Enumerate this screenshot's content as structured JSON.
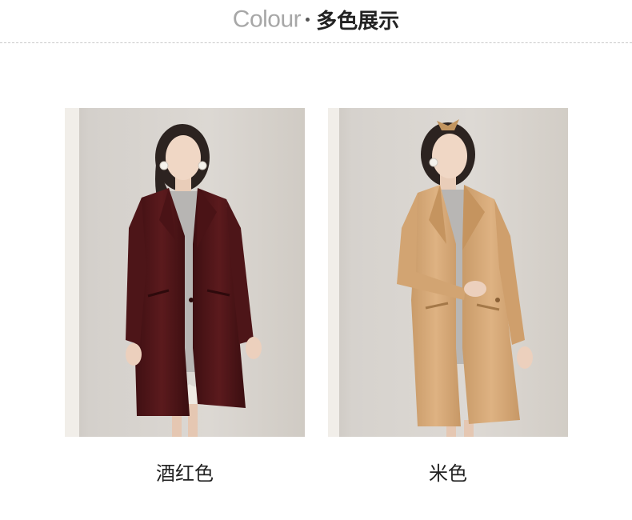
{
  "header": {
    "title_en": "Colour",
    "title_cn": "多色展示"
  },
  "colors": [
    {
      "label": "酒红色",
      "swatch": "#5a1a1c"
    },
    {
      "label": "米色",
      "swatch": "#d9ad7c"
    }
  ]
}
